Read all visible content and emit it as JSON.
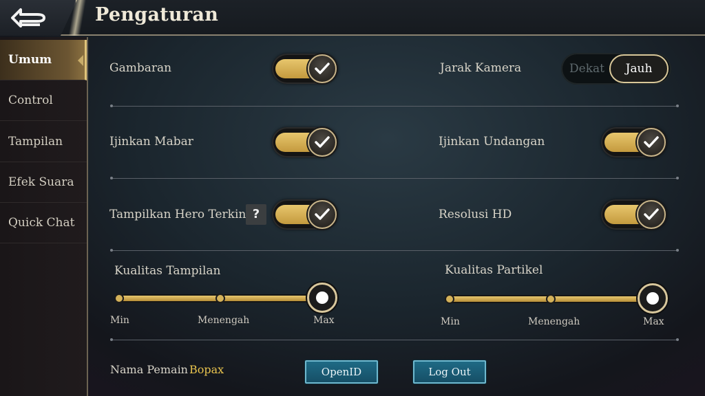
{
  "header": {
    "title": "Pengaturan",
    "back_icon": "back-arrow-icon"
  },
  "sidebar": {
    "items": [
      {
        "label": "Umum",
        "active": true
      },
      {
        "label": "Control",
        "active": false
      },
      {
        "label": "Tampilan",
        "active": false
      },
      {
        "label": "Efek Suara",
        "active": false
      },
      {
        "label": "Quick Chat",
        "active": false
      }
    ]
  },
  "settings": {
    "gambaran": {
      "label": "Gambaran",
      "on": true
    },
    "jarak_kamera": {
      "label": "Jarak Kamera",
      "options": [
        "Dekat",
        "Jauh"
      ],
      "selected": "Jauh"
    },
    "ijinkan_mabar": {
      "label": "Ijinkan Mabar",
      "on": true
    },
    "ijinkan_undangan": {
      "label": "Ijinkan Undangan",
      "on": true
    },
    "tampilkan_hero": {
      "label": "Tampilkan Hero Terkini",
      "help": "?",
      "on": true
    },
    "resolusi_hd": {
      "label": "Resolusi HD",
      "on": true
    }
  },
  "sliders": {
    "kualitas_tampilan": {
      "label": "Kualitas Tampilan",
      "ticks": [
        "Min",
        "Menengah",
        "Max"
      ],
      "value": "Max"
    },
    "kualitas_partikel": {
      "label": "Kualitas Partikel",
      "ticks": [
        "Min",
        "Menengah",
        "Max"
      ],
      "value": "Max"
    }
  },
  "footer": {
    "name_label": "Nama Pemain",
    "name_value": "Bopax",
    "openid_label": "OpenID",
    "logout_label": "Log Out"
  },
  "colors": {
    "accent_gold": "#e6c66e",
    "player_name": "#e9c44e",
    "button_blue": "#1f6a85"
  }
}
